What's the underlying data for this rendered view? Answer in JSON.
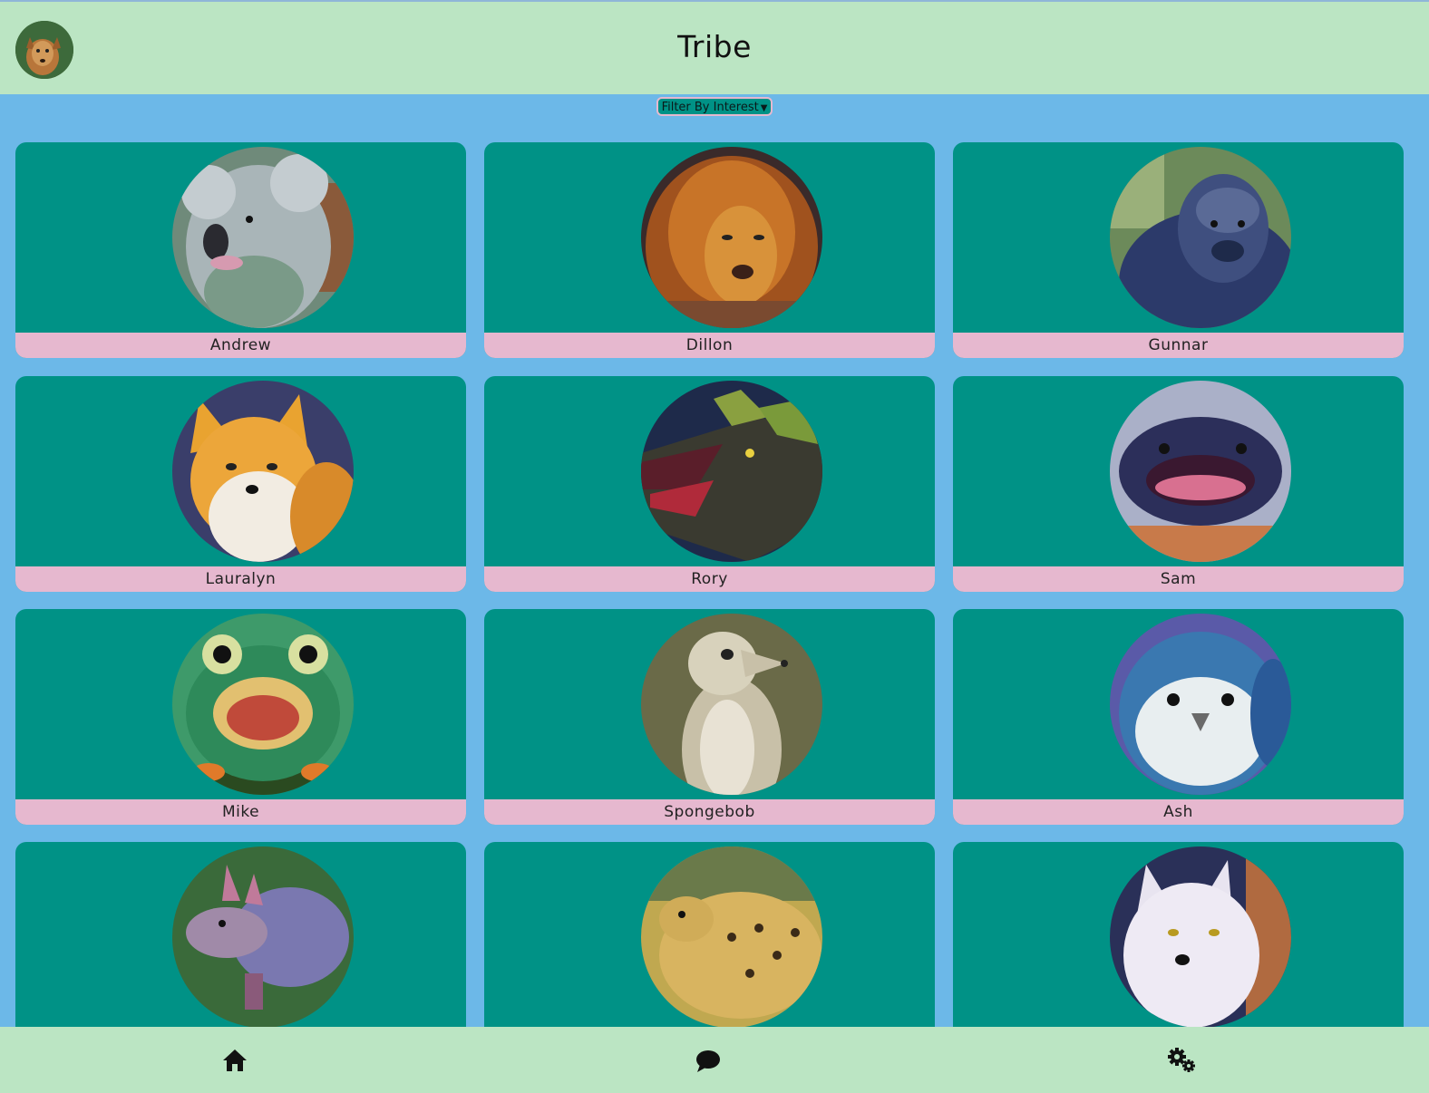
{
  "header": {
    "title": "Tribe",
    "avatar_icon": "user-avatar"
  },
  "filter": {
    "label": "Filter By Interest",
    "selected": "Filter By Interest"
  },
  "colors": {
    "topbar": "#bbe5c3",
    "page_bg": "#6cb8e8",
    "card_bg": "#009286",
    "name_bar": "#e6b8cf"
  },
  "members": [
    {
      "name": "Andrew",
      "animal": "koala"
    },
    {
      "name": "Dillon",
      "animal": "lion"
    },
    {
      "name": "Gunnar",
      "animal": "gorilla"
    },
    {
      "name": "Lauralyn",
      "animal": "fox"
    },
    {
      "name": "Rory",
      "animal": "dragon"
    },
    {
      "name": "Sam",
      "animal": "catfish"
    },
    {
      "name": "Mike",
      "animal": "frog"
    },
    {
      "name": "Spongebob",
      "animal": "meerkat"
    },
    {
      "name": "Ash",
      "animal": "bird"
    },
    {
      "name": "",
      "animal": "armadillo"
    },
    {
      "name": "",
      "animal": "cheetah"
    },
    {
      "name": "",
      "animal": "arctic-fox"
    }
  ],
  "bottom_nav": [
    {
      "icon": "home-icon"
    },
    {
      "icon": "chat-icon"
    },
    {
      "icon": "settings-icon"
    }
  ]
}
